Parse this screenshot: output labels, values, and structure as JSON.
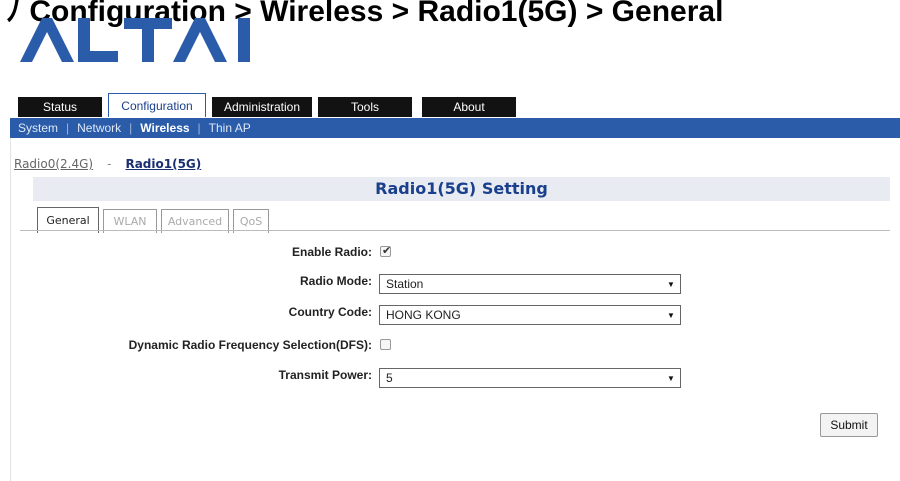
{
  "caption": "ﾉ Configuration > Wireless > Radio1(5G) > General",
  "logo": {
    "text": "ALTAI",
    "color": "#2a5caa"
  },
  "top_tabs": [
    "Status",
    "Configuration",
    "Administration",
    "Tools",
    "About"
  ],
  "active_top_tab": "Configuration",
  "subnav": [
    "System",
    "Network",
    "Wireless",
    "Thin AP"
  ],
  "active_subnav": "Wireless",
  "radio_links": {
    "radio0": "Radio0(2.4G)",
    "separator": "-",
    "radio1": "Radio1(5G)"
  },
  "section_title": "Radio1(5G) Setting",
  "sub_tabs": [
    "General",
    "WLAN",
    "Advanced",
    "QoS"
  ],
  "active_sub_tab": "General",
  "form": {
    "enable_radio_label": "Enable Radio:",
    "enable_radio_checked": true,
    "radio_mode_label": "Radio Mode:",
    "radio_mode_value": "Station",
    "country_code_label": "Country Code:",
    "country_code_value": "HONG KONG",
    "dfs_label": "Dynamic Radio Frequency Selection(DFS):",
    "dfs_checked": false,
    "transmit_power_label": "Transmit Power:",
    "transmit_power_value": "5",
    "checkmark": "✔",
    "dropdown_arrow": "▼"
  },
  "submit_label": "Submit",
  "colors": {
    "brand_blue": "#2a5caa",
    "tab_black": "#121212",
    "header_bg": "#e8ebf1"
  }
}
